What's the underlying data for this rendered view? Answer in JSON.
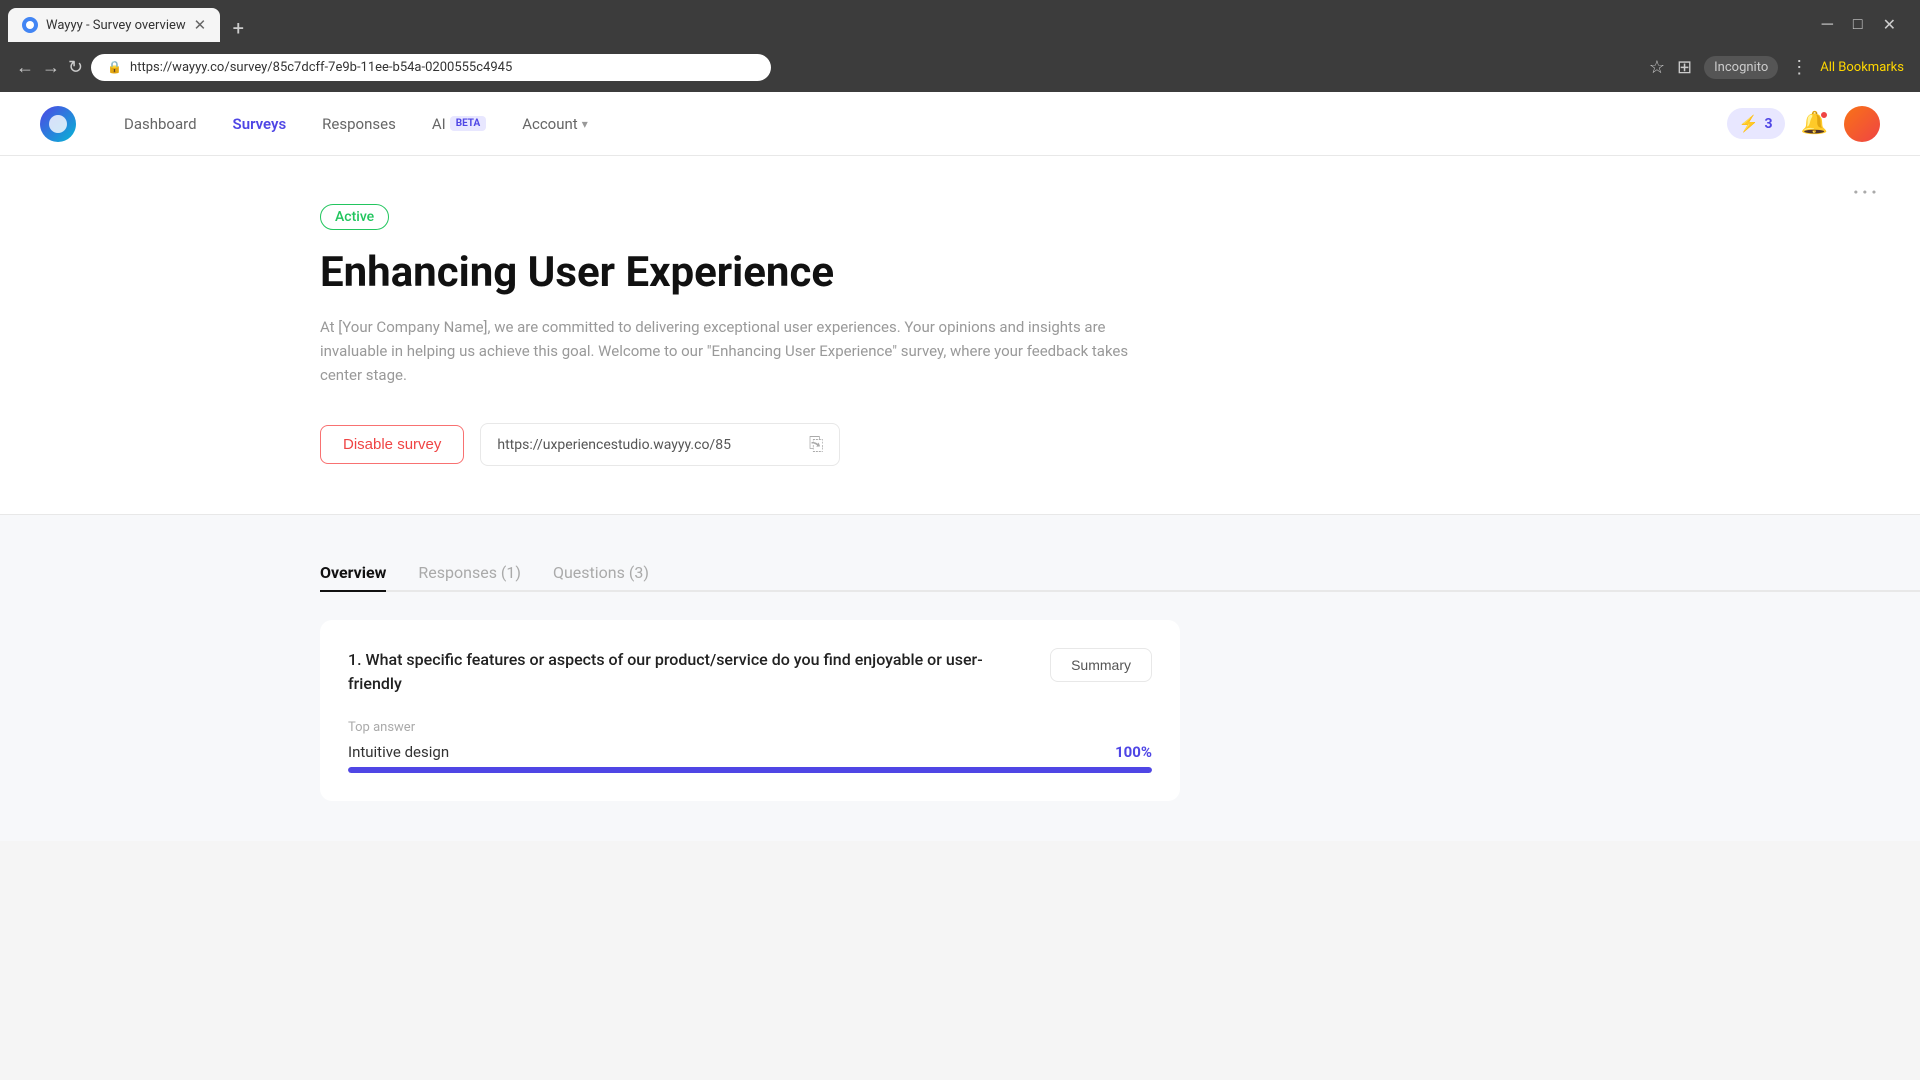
{
  "browser": {
    "tab_title": "Wayyy - Survey overview",
    "tab_favicon_color": "#4285f4",
    "address": "wayyy.co/survey/85c7dcff-7e9b-11ee-b54a-0200555c4945",
    "address_full": "https://wayyy.co/survey/85c7dcff-7e9b-11ee-b54a-0200555c4945",
    "incognito_label": "Incognito",
    "bookmarks_label": "All Bookmarks"
  },
  "nav": {
    "dashboard_label": "Dashboard",
    "surveys_label": "Surveys",
    "responses_label": "Responses",
    "ai_label": "AI",
    "beta_label": "BETA",
    "account_label": "Account",
    "points": "3"
  },
  "survey": {
    "status": "Active",
    "title": "Enhancing User Experience",
    "description": "At [Your Company Name], we are committed to delivering exceptional user experiences. Your opinions and insights are invaluable in helping us achieve this goal. Welcome to our \"Enhancing User Experience\" survey, where your feedback takes center stage.",
    "disable_btn": "Disable survey",
    "survey_url": "https://uxperiencestudio.wayyy.co/85",
    "more_icon": "···"
  },
  "tabs": [
    {
      "label": "Overview",
      "active": true
    },
    {
      "label": "Responses (1)",
      "active": false
    },
    {
      "label": "Questions (3)",
      "active": false
    }
  ],
  "question": {
    "text": "1. What specific features or aspects of our product/service do you find enjoyable or user-friendly",
    "summary_btn": "Summary",
    "top_answer_label": "Top answer",
    "top_answer_text": "Intuitive design",
    "top_answer_pct": "100%",
    "progress_width": "100"
  },
  "colors": {
    "accent": "#4f46e5",
    "active_green": "#22c55e",
    "disable_red": "#ef4444"
  }
}
